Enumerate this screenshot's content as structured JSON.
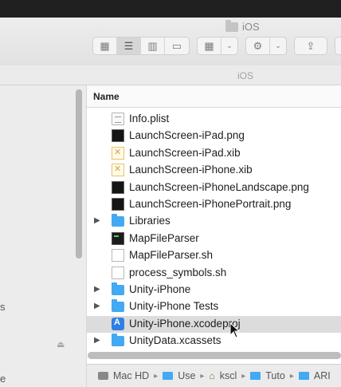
{
  "window": {
    "title": "iOS"
  },
  "toolbar": {
    "view_modes": [
      "icon-view",
      "list-view",
      "column-view",
      "gallery-view"
    ],
    "active_view": "list-view",
    "group_button_icon": "grid-icon",
    "action_button_icon": "gear-icon",
    "share_button_icon": "share-icon"
  },
  "path_header": {
    "label": "iOS"
  },
  "sidebar": {
    "partial_letters": [
      "s",
      "e"
    ]
  },
  "list": {
    "column_header": "Name",
    "rows": [
      {
        "name": "Info.plist",
        "type": "plist",
        "expandable": false
      },
      {
        "name": "LaunchScreen-iPad.png",
        "type": "png",
        "expandable": false
      },
      {
        "name": "LaunchScreen-iPad.xib",
        "type": "xib",
        "expandable": false
      },
      {
        "name": "LaunchScreen-iPhone.xib",
        "type": "xib",
        "expandable": false
      },
      {
        "name": "LaunchScreen-iPhoneLandscape.png",
        "type": "png",
        "expandable": false
      },
      {
        "name": "LaunchScreen-iPhonePortrait.png",
        "type": "png",
        "expandable": false
      },
      {
        "name": "Libraries",
        "type": "folder",
        "expandable": true
      },
      {
        "name": "MapFileParser",
        "type": "exec",
        "expandable": false
      },
      {
        "name": "MapFileParser.sh",
        "type": "doc",
        "expandable": false
      },
      {
        "name": "process_symbols.sh",
        "type": "doc",
        "expandable": false
      },
      {
        "name": "Unity-iPhone",
        "type": "folder",
        "expandable": true
      },
      {
        "name": "Unity-iPhone Tests",
        "type": "folder",
        "expandable": true
      },
      {
        "name": "Unity-iPhone.xcodeproj",
        "type": "proj",
        "expandable": false,
        "selected": true
      },
      {
        "name": "UnityData.xcassets",
        "type": "folder",
        "expandable": true
      }
    ]
  },
  "statusbar": {
    "crumbs": [
      "Mac HD",
      "Use",
      "kscl",
      "Tuto",
      "ARI"
    ]
  },
  "colors": {
    "folder_blue": "#43a9f2",
    "selection_gray": "#dcdcdc"
  }
}
